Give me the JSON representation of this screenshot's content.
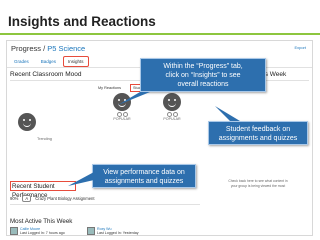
{
  "slide": {
    "title": "Insights and Reactions"
  },
  "screen": {
    "breadcrumb_main": "Progress",
    "breadcrumb_sep": " / ",
    "breadcrumb_sub": "P5 Science",
    "export_label": "Export",
    "subnav": [
      "Grades",
      "Badges",
      "Insights"
    ],
    "active_subnav": "Insights",
    "recent_mood_heading": "Recent Classroom Mood",
    "mood_tabs": [
      "My Reactions",
      "Student Reactions"
    ],
    "active_mood_tab": "Student Reactions",
    "trending_label": "Trending",
    "popular_label_1": "POPULAR",
    "popular_label_2": "POPULAR",
    "popular_content_heading": "Popular Content This Week",
    "popular_note_1": "Check back here to see what content in",
    "popular_note_2": "your group is being viewed the most",
    "recent_perf_heading": "Recent Student Performance",
    "perf_percent": "90%",
    "perf_badge": "A",
    "perf_item": "Crazy Plant Biology Assignment",
    "most_active_heading": "Most Active This Week",
    "students": [
      {
        "name": "Callie Moore",
        "meta": "Last Logged In: 7 hours ago"
      },
      {
        "name": "Roxy Wu",
        "meta": "Last Logged In: Yesterday"
      }
    ]
  },
  "callouts": {
    "insights": [
      "Within the “Progress” tab,",
      "click on “Insights” to see",
      "overall reactions"
    ],
    "feedback": [
      "Student feedback on",
      "assignments and quizzes"
    ],
    "performance": [
      "View performance data on",
      "assignments and quizzes"
    ]
  },
  "colors": {
    "accent_green": "#8dc63f",
    "callout_blue": "#2d6fae",
    "highlight_red": "#e74c3c",
    "link_blue": "#1a75bb"
  }
}
